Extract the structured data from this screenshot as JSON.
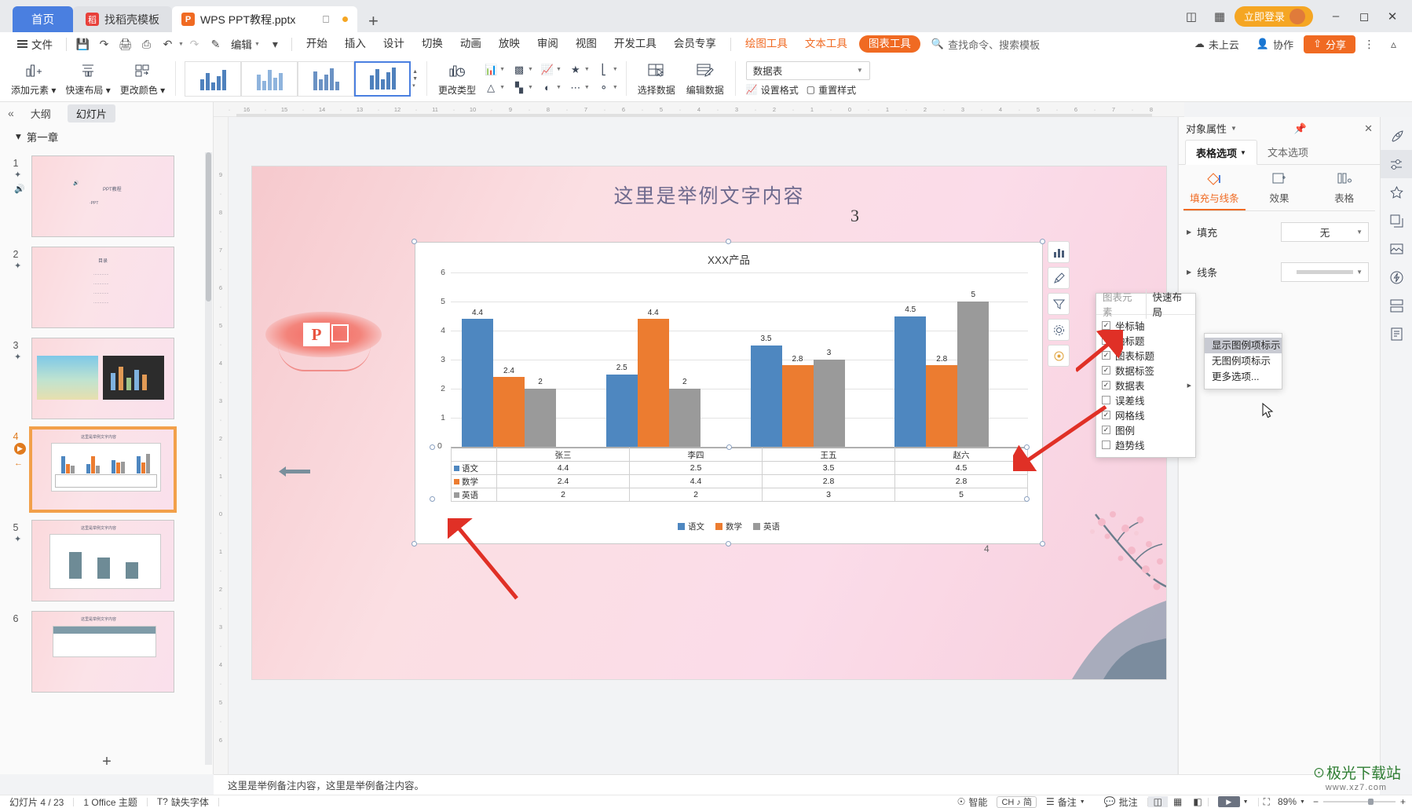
{
  "tabbar": {
    "home_tab": "首页",
    "template_tab": "找稻壳模板",
    "doc_tab": "WPS PPT教程.pptx",
    "new_tab_icon": "plus-icon",
    "login_label": "立即登录",
    "minimize_icon": "minimize-icon",
    "maximize_icon": "maximize-icon",
    "close_icon": "close-icon"
  },
  "menubar": {
    "file": "文件",
    "edit": "编辑",
    "items": [
      "开始",
      "插入",
      "设计",
      "切换",
      "动画",
      "放映",
      "审阅",
      "视图",
      "开发工具",
      "会员专享"
    ],
    "context_tools": [
      "绘图工具",
      "文本工具"
    ],
    "active_context_tool": "图表工具",
    "search_placeholder": "查找命令、搜索模板",
    "cloud_status": "未上云",
    "collaborate": "协作",
    "share": "分享"
  },
  "ribbon": {
    "add_element": "添加元素",
    "quick_layout": "快速布局",
    "change_color": "更改颜色",
    "change_type": "更改类型",
    "select_data": "选择数据",
    "edit_data": "编辑数据",
    "chart_element_select": "数据表",
    "set_format": "设置格式",
    "reset_style": "重置样式"
  },
  "leftpanel": {
    "outline_tab": "大纲",
    "slides_tab": "幻灯片",
    "chapter": "第一章",
    "slides": [
      {
        "num": "1",
        "title": "PPT教程",
        "sub": "·PPT"
      },
      {
        "num": "2",
        "title": "目录"
      },
      {
        "num": "3",
        "title": ""
      },
      {
        "num": "4",
        "title": "这里是举例文字内容"
      },
      {
        "num": "5",
        "title": "这里是举例文字内容"
      },
      {
        "num": "6",
        "title": "这里是举例文字内容"
      }
    ]
  },
  "slide": {
    "title": "这里是举例文字内容",
    "page_number": "3",
    "bottom_number": "4",
    "logo_letter": "P"
  },
  "chart_data": {
    "type": "bar",
    "title": "XXX产品",
    "categories": [
      "张三",
      "李四",
      "王五",
      "赵六"
    ],
    "series": [
      {
        "name": "语文",
        "color": "#4e87c0",
        "values": [
          4.4,
          2.5,
          3.5,
          4.5
        ],
        "labels": [
          "4.4",
          "2.5",
          "3.5",
          "4.5"
        ]
      },
      {
        "name": "数学",
        "color": "#ec7c30",
        "values": [
          2.4,
          4.4,
          2.8,
          2.8
        ],
        "labels": [
          "2.4",
          "4.4",
          "2.8",
          "2.8"
        ]
      },
      {
        "name": "英语",
        "color": "#9a9a9a",
        "values": [
          2,
          2,
          3,
          5
        ],
        "labels": [
          "2",
          "2",
          "3",
          "5"
        ]
      }
    ],
    "ylim": [
      0,
      6
    ],
    "yticks": [
      "0",
      "1",
      "2",
      "3",
      "4",
      "5",
      "6"
    ],
    "xlabel": "",
    "ylabel": "",
    "grid": true,
    "legend_position": "bottom",
    "data_table_shown": true
  },
  "chart_side_tools": [
    {
      "icon": "chart-style-icon",
      "name": "chart-elements"
    },
    {
      "icon": "brush-icon",
      "name": "chart-style"
    },
    {
      "icon": "filter-icon",
      "name": "chart-filter"
    },
    {
      "icon": "gear-icon",
      "name": "chart-settings"
    },
    {
      "icon": "target-icon",
      "name": "chart-locate"
    }
  ],
  "popup": {
    "tab_elements": "图表元素",
    "tab_quick_layout": "快速布局",
    "items": [
      {
        "label": "坐标轴",
        "checked": true,
        "submenu": false
      },
      {
        "label": "轴标题",
        "checked": false,
        "submenu": false
      },
      {
        "label": "图表标题",
        "checked": true,
        "submenu": false
      },
      {
        "label": "数据标签",
        "checked": true,
        "submenu": false
      },
      {
        "label": "数据表",
        "checked": true,
        "submenu": true
      },
      {
        "label": "误差线",
        "checked": false,
        "submenu": false
      },
      {
        "label": "网格线",
        "checked": true,
        "submenu": false
      },
      {
        "label": "图例",
        "checked": true,
        "submenu": false
      },
      {
        "label": "趋势线",
        "checked": false,
        "submenu": false
      }
    ],
    "submenu_items": [
      {
        "label": "显示图例项标示",
        "highlighted": true
      },
      {
        "label": "无图例项标示",
        "highlighted": false
      },
      {
        "label": "更多选项...",
        "highlighted": false
      }
    ]
  },
  "rightpanel": {
    "title": "对象属性",
    "pin_icon": "pin-icon",
    "close_icon": "close-icon",
    "tabs": [
      {
        "label": "表格选项",
        "active": true
      },
      {
        "label": "文本选项",
        "active": false
      }
    ],
    "subtabs": [
      {
        "label": "填充与线条",
        "active": true,
        "icon": "fill-line-icon"
      },
      {
        "label": "效果",
        "active": false,
        "icon": "effects-icon"
      },
      {
        "label": "表格",
        "active": false,
        "icon": "table-icon"
      }
    ],
    "rows": [
      {
        "label": "填充",
        "value": "无",
        "type": "select"
      },
      {
        "label": "线条",
        "value": "",
        "type": "lineswatch"
      }
    ]
  },
  "rail": [
    {
      "icon": "rocket-icon",
      "name": "ai-tools"
    },
    {
      "icon": "properties-icon",
      "name": "object-properties",
      "selected": true
    },
    {
      "icon": "star-icon",
      "name": "favorites"
    },
    {
      "icon": "copy-icon",
      "name": "duplicate"
    },
    {
      "icon": "image-icon",
      "name": "image-library"
    },
    {
      "icon": "lightning-icon",
      "name": "quick-actions"
    },
    {
      "icon": "layers-icon",
      "name": "selection-pane"
    },
    {
      "icon": "document-icon",
      "name": "document-pane"
    }
  ],
  "notes": {
    "text": "这里是举例备注内容，这里是举例备注内容。"
  },
  "statusbar": {
    "slide_counter": "幻灯片 4 / 23",
    "theme": "1 Office 主题",
    "missing_font": "缺失字体",
    "smart": "智能",
    "ime": "CH ♪ 简",
    "notes_btn": "备注",
    "comment_btn": "批注",
    "view_normal": "normal-view-icon",
    "view_sorter": "slide-sorter-icon",
    "view_reading": "reading-view-icon",
    "play_icon": "play-icon",
    "fit_icon": "fit-to-window-icon",
    "zoom": "89%",
    "zoom_out": "−",
    "zoom_in": "+"
  },
  "watermark": {
    "line1": "极光下载站",
    "line2": "www.xz7.com"
  },
  "colors": {
    "accent_orange": "#f06a22",
    "accent_blue": "#4a7fe0",
    "series_blue": "#4e87c0",
    "series_orange": "#ec7c30",
    "series_gray": "#9a9a9a",
    "annotation_red": "#e03026"
  }
}
